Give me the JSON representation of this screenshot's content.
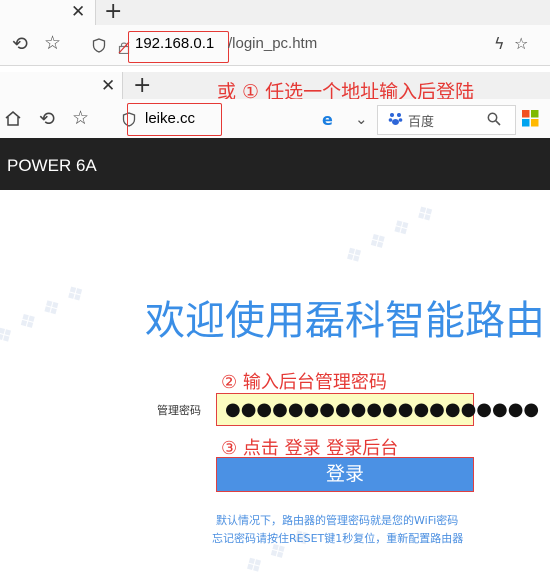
{
  "window1": {
    "url_host": "192.168.0.1",
    "url_path": "/login_pc.htm",
    "icons": [
      "close-icon",
      "plus-icon",
      "undo-icon",
      "star-icon",
      "shield-icon",
      "lock-icon",
      "bolt-icon",
      "star-icon"
    ]
  },
  "window2": {
    "url": "leike.cc",
    "search_text": "百度",
    "icons": [
      "close-icon",
      "plus-icon",
      "home-icon",
      "undo-icon",
      "star-icon",
      "shield-icon",
      "ie-icon",
      "chevron-down-icon",
      "baidu-icon",
      "search-icon",
      "apps-icon"
    ]
  },
  "annotations": {
    "step1": "或 ① 任选一个地址输入后登陆",
    "step2": "② 输入后台管理密码",
    "step3": "③ 点击 登录 登录后台"
  },
  "router": {
    "name": "POWER 6A",
    "welcome": "欢迎使用磊科智能路由",
    "password_label": "管理密码",
    "password_value": "●●●●●●●●●●●●●●●●●●●●",
    "login_label": "登录",
    "info_line1": "默认情况下，路由器的管理密码就是您的WiFi密码",
    "info_line2": "忘记密码请按住RESET键1秒复位，重新配置路由器"
  },
  "colors": {
    "accent": "#3a8ee6",
    "button": "#4b91e4",
    "annotation_red": "#e53935",
    "header_dark": "#222222",
    "input_bg": "#fcfcc0"
  }
}
